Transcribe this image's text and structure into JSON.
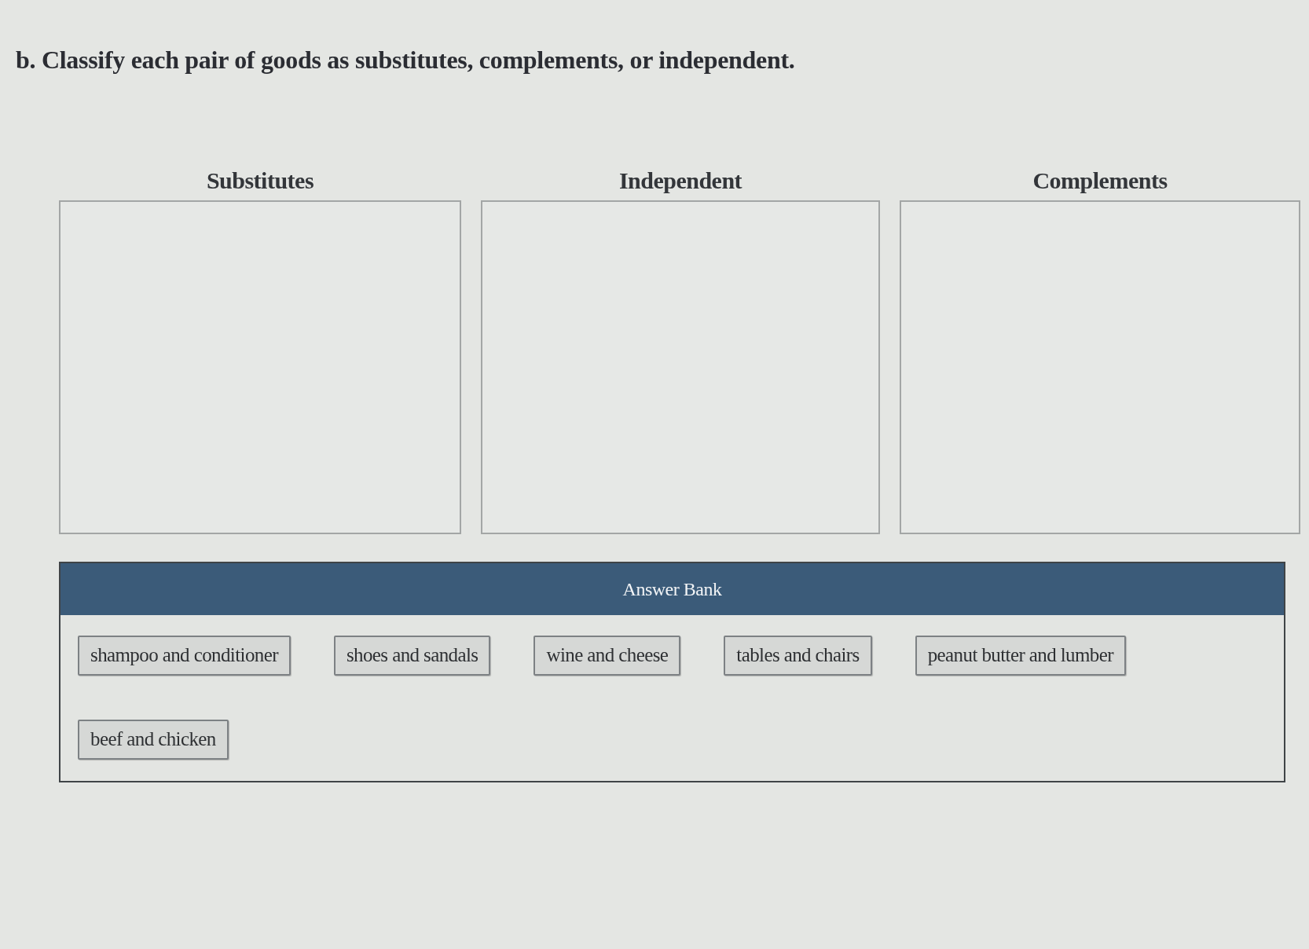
{
  "prompt": "b. Classify each pair of goods as substitutes, complements, or independent.",
  "categories": [
    {
      "label": "Substitutes"
    },
    {
      "label": "Independent"
    },
    {
      "label": "Complements"
    }
  ],
  "answer_bank": {
    "title": "Answer Bank",
    "items": [
      "shampoo and conditioner",
      "shoes and sandals",
      "wine and cheese",
      "tables and chairs",
      "peanut butter and lumber",
      "beef and chicken"
    ]
  }
}
